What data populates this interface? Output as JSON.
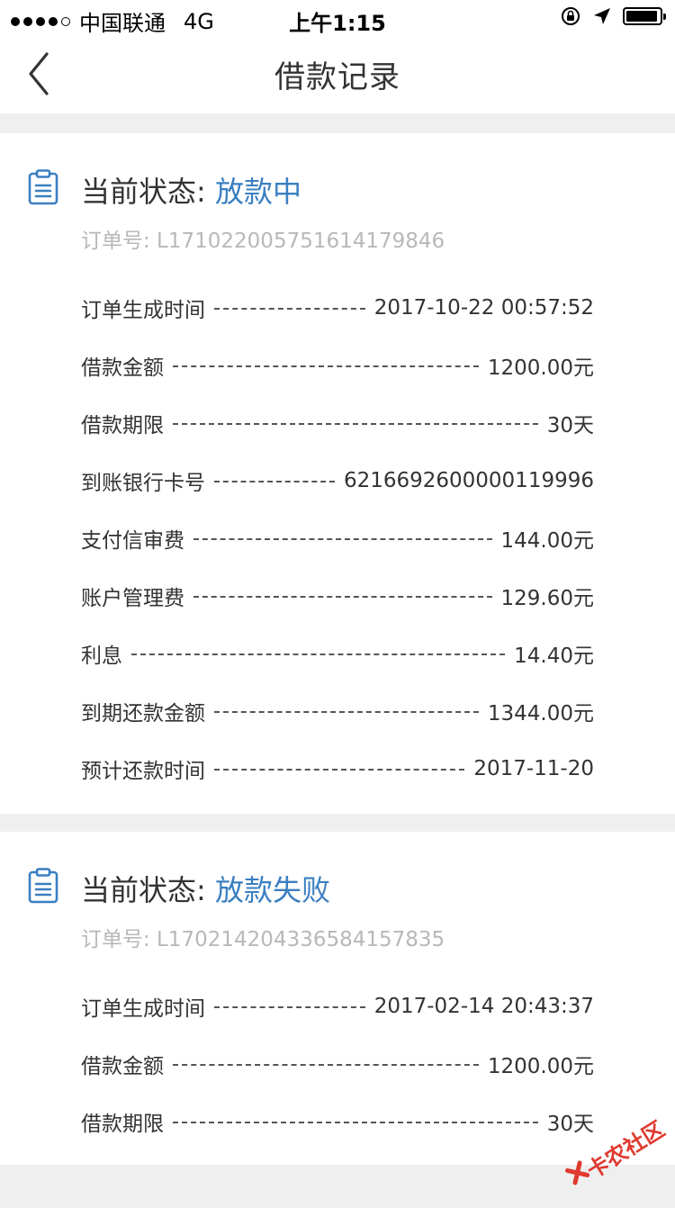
{
  "status_bar": {
    "carrier": "中国联通",
    "network": "4G",
    "time": "上午1:15",
    "signal_dots": 5,
    "signal_filled": 4,
    "battery_level": 0.95
  },
  "nav": {
    "title": "借款记录"
  },
  "records": [
    {
      "status_label": "当前状态: ",
      "status_value": "放款中",
      "order_no": "订单号: L171022005751614179846",
      "rows": [
        {
          "label": "订单生成时间",
          "value": "2017-10-22 00:57:52"
        },
        {
          "label": "借款金额",
          "value": "1200.00元"
        },
        {
          "label": "借款期限",
          "value": "30天"
        },
        {
          "label": "到账银行卡号",
          "value": "6216692600000119996"
        },
        {
          "label": "支付信审费",
          "value": "144.00元"
        },
        {
          "label": "账户管理费",
          "value": "129.60元"
        },
        {
          "label": "利息",
          "value": "14.40元"
        },
        {
          "label": "到期还款金额",
          "value": "1344.00元"
        },
        {
          "label": "预计还款时间",
          "value": "2017-11-20"
        }
      ]
    },
    {
      "status_label": "当前状态: ",
      "status_value": "放款失败",
      "order_no": "订单号: L170214204336584157835",
      "rows": [
        {
          "label": "订单生成时间",
          "value": "2017-02-14 20:43:37"
        },
        {
          "label": "借款金额",
          "value": "1200.00元"
        },
        {
          "label": "借款期限",
          "value": "30天"
        }
      ]
    }
  ],
  "watermark": {
    "text": "卡农社区"
  },
  "colors": {
    "accent": "#3a7fc1",
    "background": "#efeff0",
    "muted_text": "#b8b8b8",
    "watermark": "#e03a2f"
  }
}
